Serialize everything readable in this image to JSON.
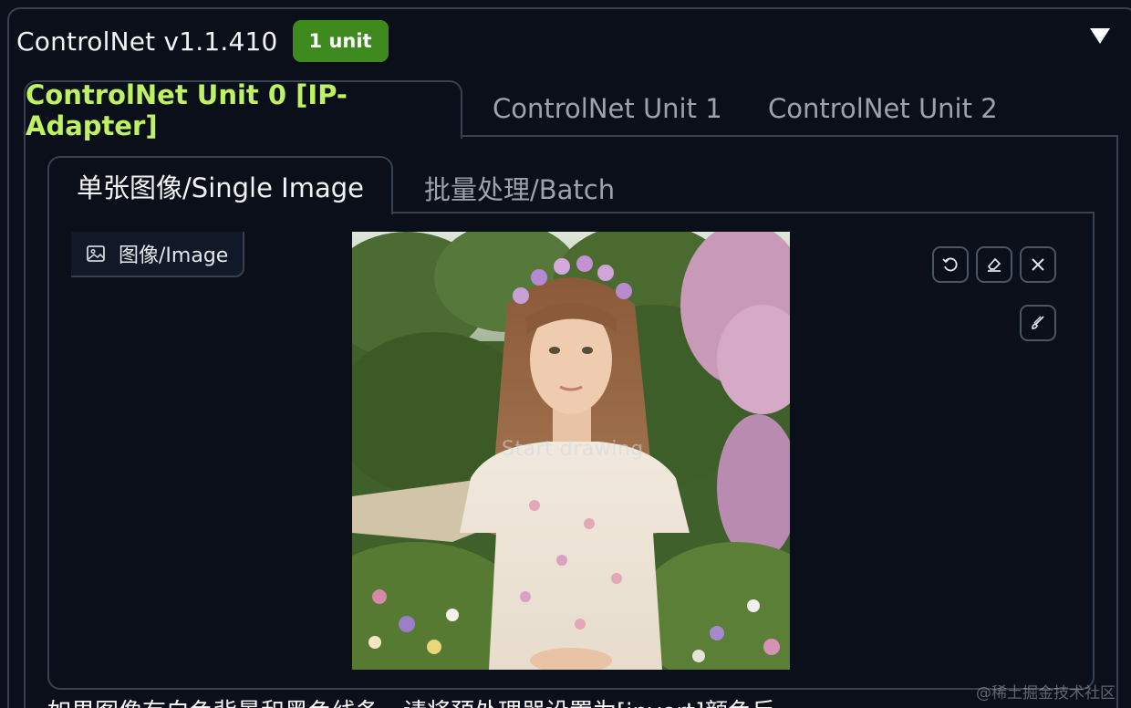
{
  "accordion": {
    "title": "ControlNet v1.1.410",
    "badge": "1 unit",
    "collapse_icon": "triangle-down-icon"
  },
  "unit_tabs": [
    {
      "label": "ControlNet Unit 0 [IP-Adapter]",
      "active": true
    },
    {
      "label": "ControlNet Unit 1",
      "active": false
    },
    {
      "label": "ControlNet Unit 2",
      "active": false
    }
  ],
  "mode_tabs": [
    {
      "label": "单张图像/Single Image",
      "active": true
    },
    {
      "label": "批量处理/Batch",
      "active": false
    }
  ],
  "image_input": {
    "label": "图像/Image",
    "label_icon": "image-icon",
    "overlay_text": "Start drawing"
  },
  "tools": [
    {
      "name": "undo",
      "icon": "undo-icon"
    },
    {
      "name": "erase",
      "icon": "eraser-icon"
    },
    {
      "name": "clear",
      "icon": "close-icon"
    },
    {
      "name": "brush",
      "icon": "brush-icon"
    }
  ],
  "bottom_text": "如果图像有白色背景和黑色线条，请将预处理器设置为[invert]颜色反",
  "watermark": "@稀土掘金技术社区",
  "colors": {
    "background": "#0b0f19",
    "border": "#374151",
    "active_tab_text": "#bef264",
    "badge": "#3f8a1f"
  }
}
